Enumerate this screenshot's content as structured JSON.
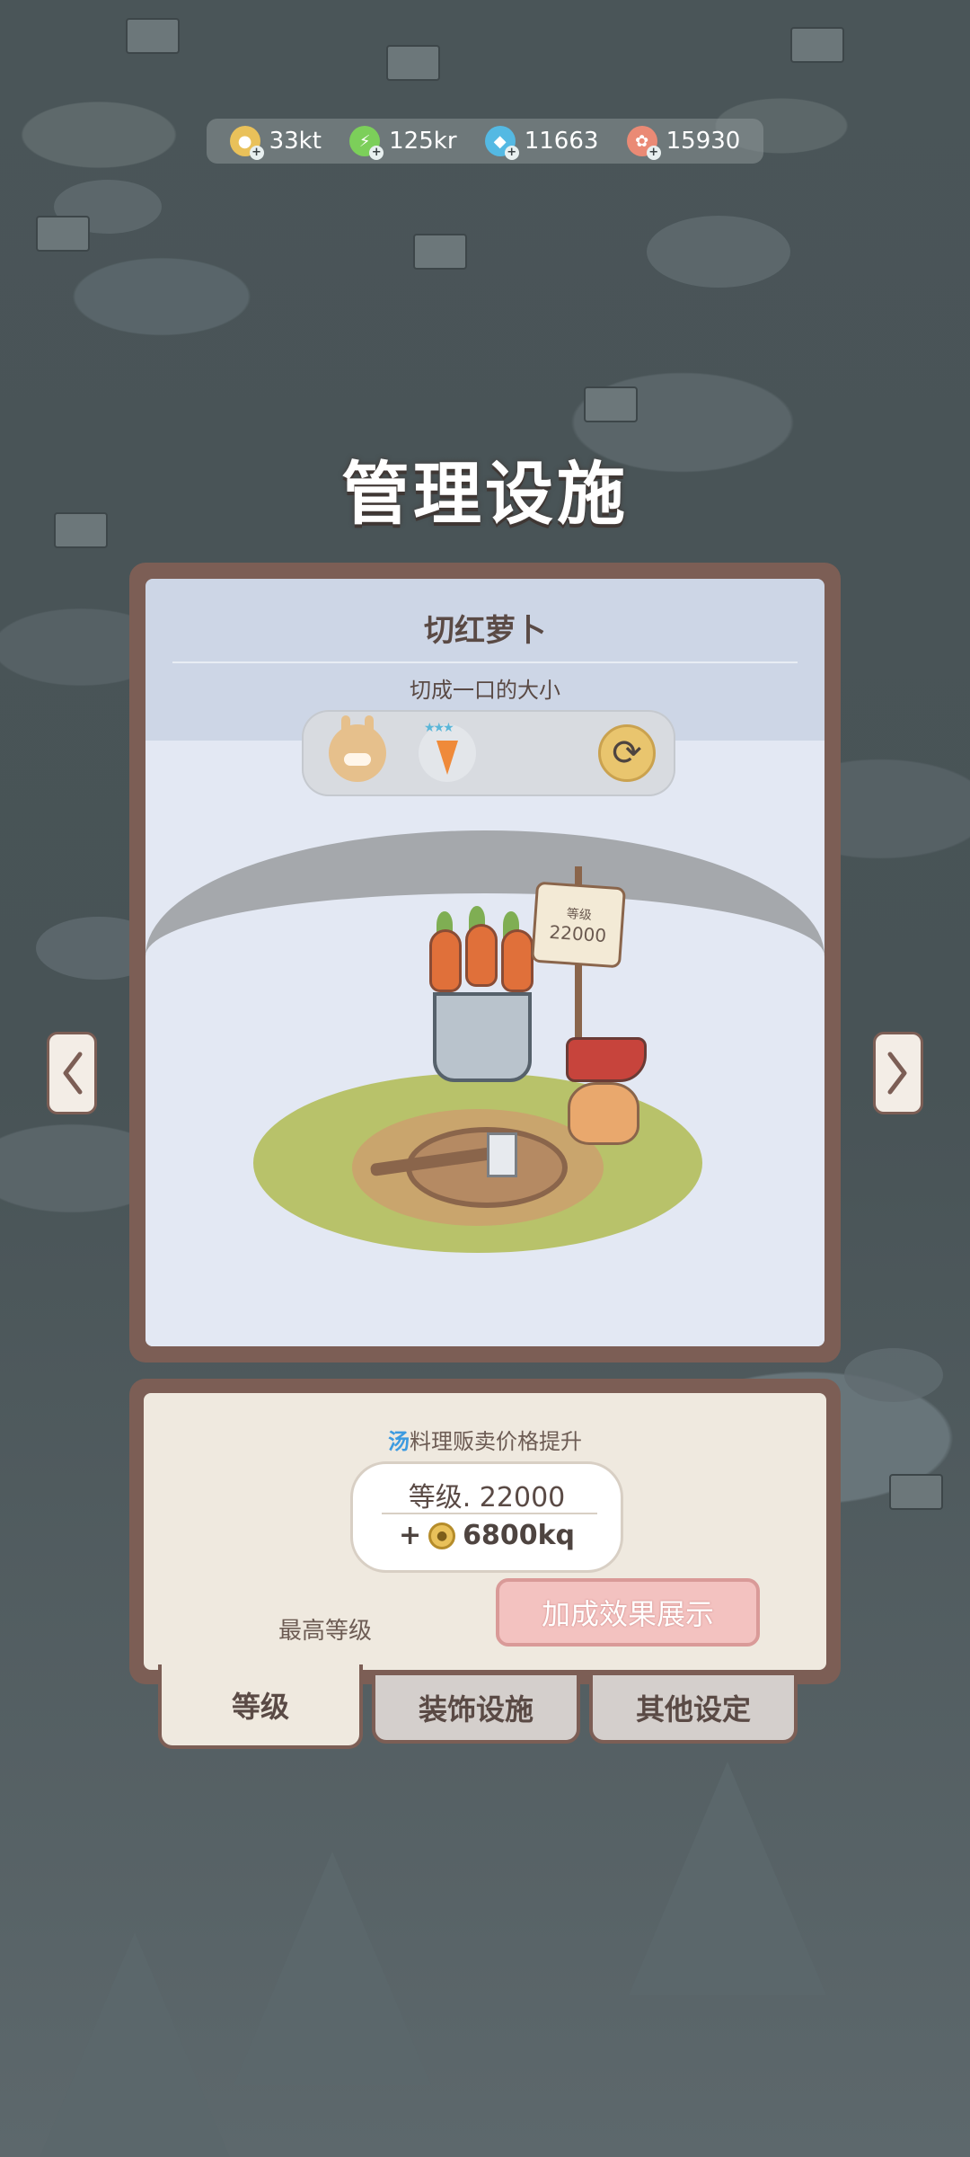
{
  "resources": [
    {
      "name": "coin",
      "icon": "coin-icon",
      "value": "33kt",
      "color": "#e9c15a"
    },
    {
      "name": "energy",
      "icon": "lightning-icon",
      "value": "125kr",
      "color": "#7ccf5a"
    },
    {
      "name": "gem",
      "icon": "diamond-icon",
      "value": "11663",
      "color": "#54b9e3"
    },
    {
      "name": "paw",
      "icon": "paw-icon",
      "value": "15930",
      "color": "#ea8a75"
    }
  ],
  "page_title": "管理设施",
  "facility": {
    "name": "切红萝卜",
    "description": "切成一口的大小",
    "banner_label": "等级",
    "banner_value": "22000"
  },
  "level_panel": {
    "effect_keyword": "汤",
    "effect_text": "料理贩卖价格提升",
    "level_text": "等级. 22000",
    "bonus_prefix": "+",
    "bonus_value": "6800kq",
    "max_level_label": "最高等级",
    "bonus_button_label": "加成效果展示"
  },
  "tabs": [
    {
      "label": "等级",
      "active": true
    },
    {
      "label": "装饰设施",
      "active": false
    },
    {
      "label": "其他设定",
      "active": false
    }
  ]
}
